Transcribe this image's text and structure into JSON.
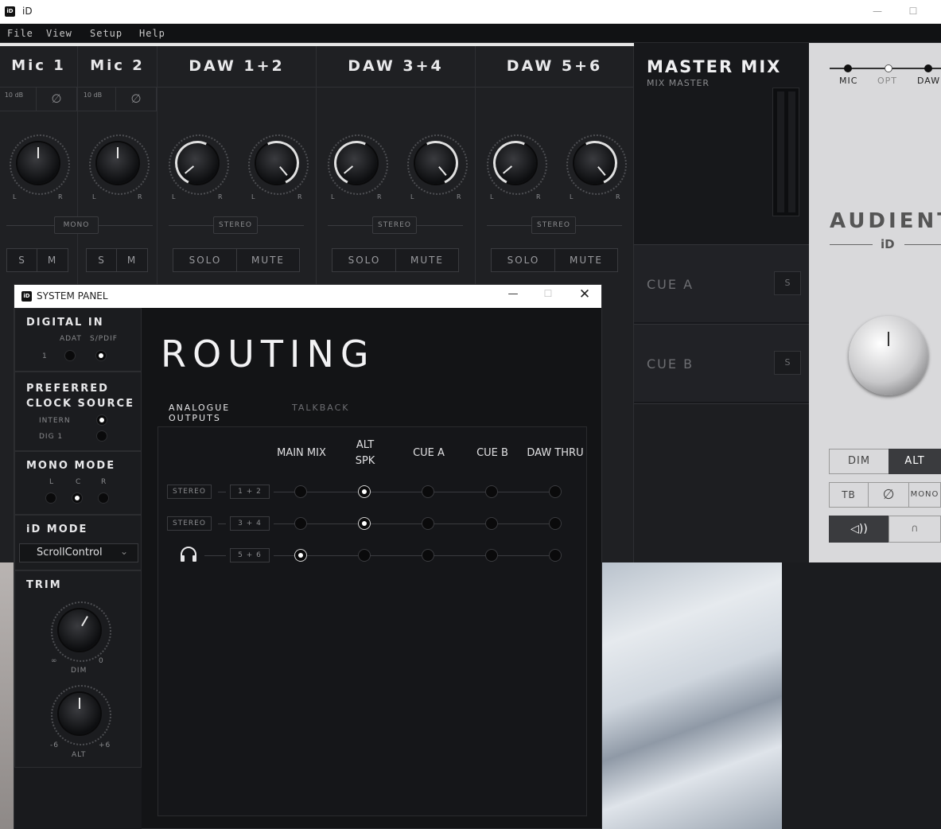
{
  "app": {
    "title": "iD",
    "icon_label": "iD"
  },
  "menu": [
    "File",
    "View",
    "Setup",
    "Help"
  ],
  "channels": [
    {
      "name": "Mic 1",
      "pad": "10 dB",
      "mode": "MONO",
      "solo": "S",
      "mute": "M"
    },
    {
      "name": "Mic 2",
      "pad": "10 dB",
      "solo": "S",
      "mute": "M"
    },
    {
      "name": "DAW 1+2",
      "mode": "STEREO",
      "solo": "SOLO",
      "mute": "MUTE"
    },
    {
      "name": "DAW 3+4",
      "mode": "STEREO",
      "solo": "SOLO",
      "mute": "MUTE"
    },
    {
      "name": "DAW 5+6",
      "mode": "STEREO",
      "solo": "SOLO",
      "mute": "MUTE"
    }
  ],
  "knob_labels": {
    "left": "L",
    "right": "R"
  },
  "master": {
    "title": "MASTER MIX",
    "subtitle": "MIX MASTER",
    "cue_a": "CUE A",
    "cue_b": "CUE B",
    "s": "S"
  },
  "device": {
    "inputs": [
      "MIC",
      "OPT",
      "DAW"
    ],
    "brand": "AUDIENT",
    "model": "iD",
    "buttons": {
      "dim": "DIM",
      "alt": "ALT",
      "tb": "TB",
      "mono": "MONO"
    }
  },
  "system_panel": {
    "title": "SYSTEM PANEL",
    "digital_in": {
      "heading": "DIGITAL IN",
      "adat": "ADAT",
      "spdif": "S/PDIF",
      "num": "1"
    },
    "clock": {
      "heading_1": "PREFERRED",
      "heading_2": "CLOCK SOURCE",
      "intern": "INTERN",
      "dig": "DIG 1"
    },
    "mono_mode": {
      "heading": "MONO MODE",
      "l": "L",
      "c": "C",
      "r": "R"
    },
    "id_mode": {
      "heading": "iD MODE",
      "value": "ScrollControl"
    },
    "trim": {
      "heading": "TRIM",
      "dim_min": "∞",
      "dim_max": "0",
      "dim_label": "DIM",
      "alt_min": "-6",
      "alt_max": "+6",
      "alt_label": "ALT"
    }
  },
  "routing": {
    "title": "ROUTING",
    "tabs": [
      "ANALOGUE OUTPUTS",
      "TALKBACK"
    ],
    "columns": [
      "MAIN MIX",
      "ALT\nSPK",
      "CUE A",
      "CUE B",
      "DAW THRU"
    ],
    "rows": [
      {
        "type": "STEREO",
        "pair": "1 + 2",
        "selected": 1
      },
      {
        "type": "STEREO",
        "pair": "3 + 4",
        "selected": 1
      },
      {
        "type": "headphones",
        "pair": "5 + 6",
        "selected": 0
      }
    ]
  }
}
